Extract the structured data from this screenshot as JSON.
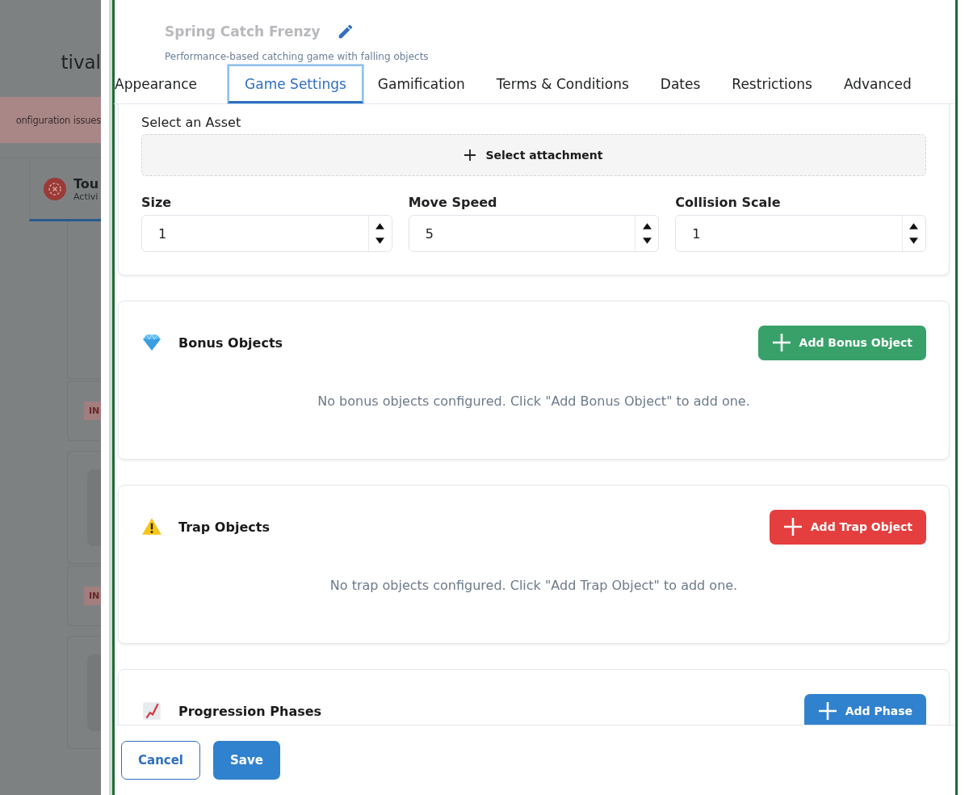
{
  "background_page": {
    "title": "tival",
    "alert": "onfiguration issues",
    "tab": {
      "title": "Tou",
      "subtitle": "Activi"
    },
    "badges": [
      "IN",
      "IN"
    ]
  },
  "drawer": {
    "title": "Spring Catch Frenzy",
    "subtitle": "Performance-based catching game with falling objects",
    "tabs": [
      {
        "label": "Appearance",
        "selected": false
      },
      {
        "label": "Game Settings",
        "selected": true
      },
      {
        "label": "Gamification",
        "selected": false
      },
      {
        "label": "Terms & Conditions",
        "selected": false
      },
      {
        "label": "Dates",
        "selected": false
      },
      {
        "label": "Restrictions",
        "selected": false
      },
      {
        "label": "Advanced",
        "selected": false
      }
    ],
    "asset": {
      "label": "Select an Asset",
      "button": "Select attachment"
    },
    "fields": [
      {
        "label": "Size",
        "value": "1"
      },
      {
        "label": "Move Speed",
        "value": "5"
      },
      {
        "label": "Collision Scale",
        "value": "1"
      }
    ],
    "sections": [
      {
        "kind": "bonus",
        "title": "Bonus Objects",
        "button": "Add Bonus Object",
        "empty": "No bonus objects configured. Click \"Add Bonus Object\" to add one."
      },
      {
        "kind": "trap",
        "title": "Trap Objects",
        "button": "Add Trap Object",
        "empty": "No trap objects configured. Click \"Add Trap Object\" to add one."
      },
      {
        "kind": "phases",
        "title": "Progression Phases",
        "button": "Add Phase"
      }
    ],
    "footer": {
      "buttons": [
        {
          "label": "Cancel",
          "kind": "secondary"
        },
        {
          "label": "Save",
          "kind": "primary"
        }
      ]
    }
  }
}
